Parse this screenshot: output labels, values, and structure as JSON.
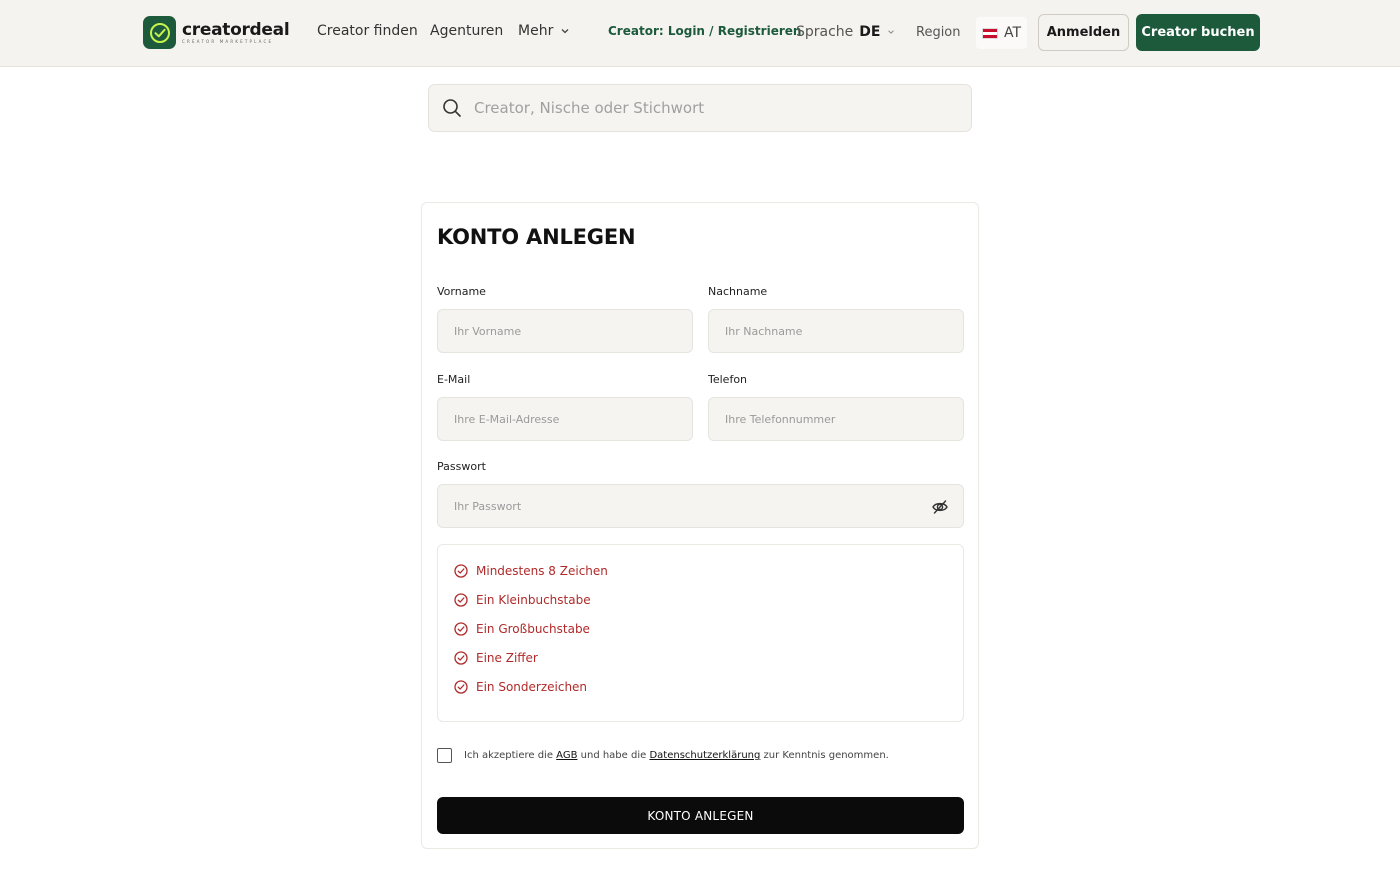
{
  "header": {
    "logo": {
      "name": "creatordeal",
      "tagline": "CREATOR MARKETPLACE",
      "icon": "check-circle-icon"
    },
    "nav": {
      "find_creator": "Creator finden",
      "agencies": "Agenturen",
      "more": "Mehr"
    },
    "creator_login": "Creator: Login / Registrieren",
    "language": {
      "label": "Sprache",
      "value": "DE"
    },
    "region": {
      "label": "Region",
      "value": "AT"
    },
    "login_button": "Anmelden",
    "book_button": "Creator buchen"
  },
  "search": {
    "placeholder": "Creator, Nische oder Stichwort"
  },
  "form": {
    "title": "KONTO ANLEGEN",
    "first_name": {
      "label": "Vorname",
      "placeholder": "Ihr Vorname"
    },
    "last_name": {
      "label": "Nachname",
      "placeholder": "Ihr Nachname"
    },
    "email": {
      "label": "E-Mail",
      "placeholder": "Ihre E-Mail-Adresse"
    },
    "phone": {
      "label": "Telefon",
      "placeholder": "Ihre Telefonnummer"
    },
    "password": {
      "label": "Passwort",
      "placeholder": "Ihr Passwort"
    },
    "requirements": [
      "Mindestens 8 Zeichen",
      "Ein Kleinbuchstabe",
      "Ein Großbuchstabe",
      "Eine Ziffer",
      "Ein Sonderzeichen"
    ],
    "terms": {
      "prefix": "Ich akzeptiere die",
      "agb": "AGB",
      "middle": "und habe die",
      "privacy": "Datenschutzerklärung",
      "suffix": "zur Kenntnis genommen."
    },
    "submit": "KONTO ANLEGEN"
  },
  "colors": {
    "brand": "#1d5a3c",
    "error": "#b02a2a",
    "submit": "#0b0b0b"
  }
}
